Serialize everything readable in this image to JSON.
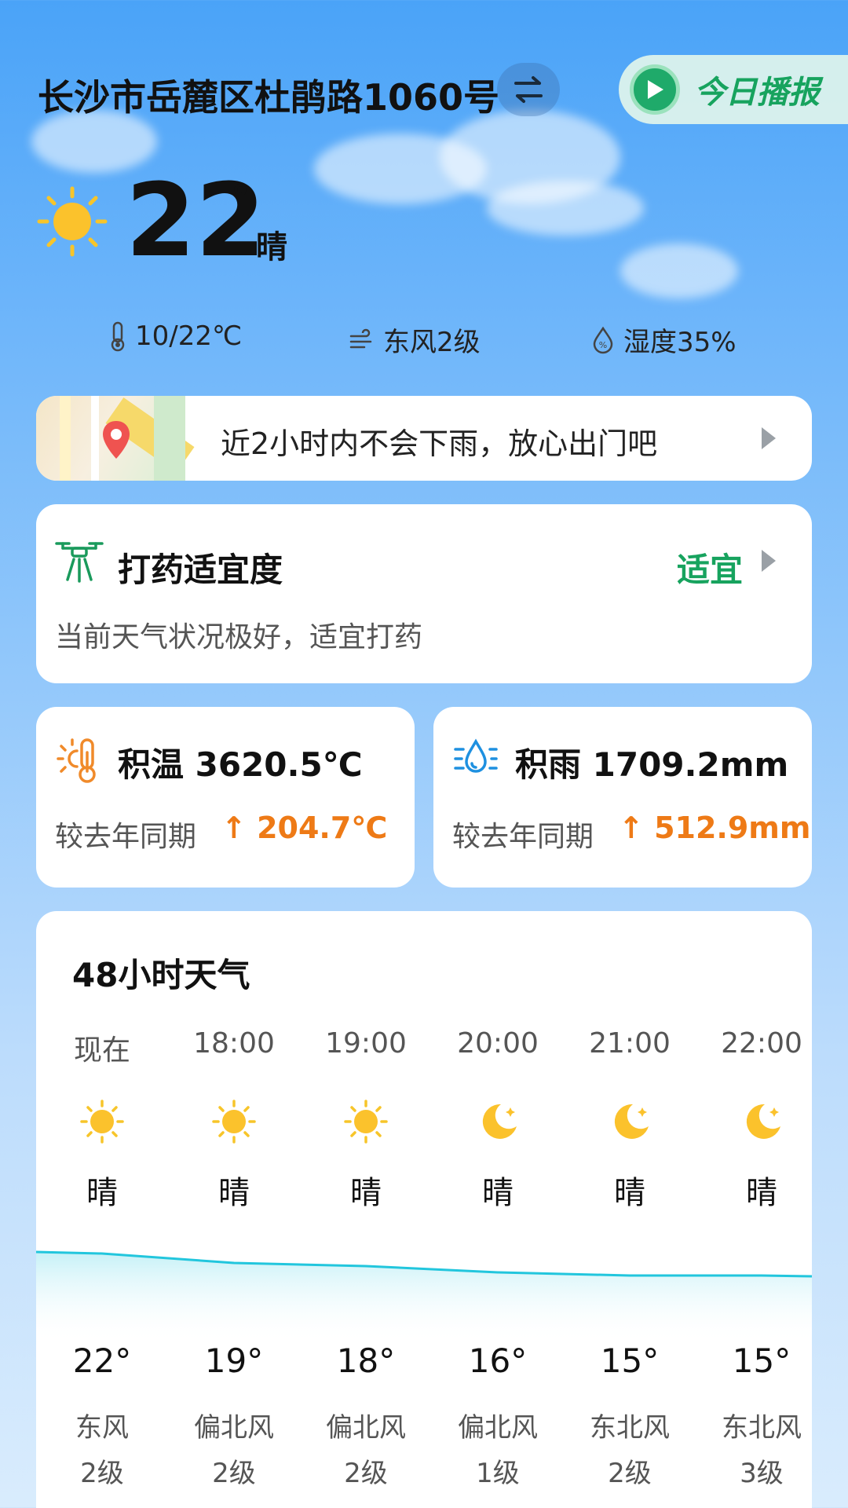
{
  "header": {
    "location": "长沙市岳麓区杜鹃路1060号",
    "broadcast_label": "今日播报"
  },
  "current": {
    "temp": "22",
    "deg": "°",
    "condition": "晴",
    "temp_range": "10/22℃",
    "wind": "东风2级",
    "humidity": "湿度35%"
  },
  "rain_notice": {
    "text": "近2小时内不会下雨，放心出门吧"
  },
  "spray": {
    "title": "打药适宜度",
    "status": "适宜",
    "description": "当前天气状况极好，适宜打药"
  },
  "accum_temp": {
    "title": "积温 3620.5℃",
    "compare": "较去年同期",
    "delta": "↑ 204.7℃"
  },
  "accum_rain": {
    "title": "积雨 1709.2mm",
    "compare": "较去年同期",
    "delta": "↑ 512.9mm"
  },
  "forecast": {
    "title": "48小时天气",
    "hours": [
      {
        "time": "现在",
        "icon": "sun-icon",
        "cond": "晴",
        "temp": "22°",
        "wind": "东风",
        "level": "2级"
      },
      {
        "time": "18:00",
        "icon": "sun-icon",
        "cond": "晴",
        "temp": "19°",
        "wind": "偏北风",
        "level": "2级"
      },
      {
        "time": "19:00",
        "icon": "sun-icon",
        "cond": "晴",
        "temp": "18°",
        "wind": "偏北风",
        "level": "2级"
      },
      {
        "time": "20:00",
        "icon": "moon-icon",
        "cond": "晴",
        "temp": "16°",
        "wind": "偏北风",
        "level": "1级"
      },
      {
        "time": "21:00",
        "icon": "moon-icon",
        "cond": "晴",
        "temp": "15°",
        "wind": "东北风",
        "level": "2级"
      },
      {
        "time": "22:00",
        "icon": "moon-icon",
        "cond": "晴",
        "temp": "15°",
        "wind": "东北风",
        "level": "3级"
      }
    ]
  },
  "colors": {
    "accent_green": "#17a35e",
    "accent_orange": "#ee7a16",
    "line_cyan": "#22c6dd"
  }
}
